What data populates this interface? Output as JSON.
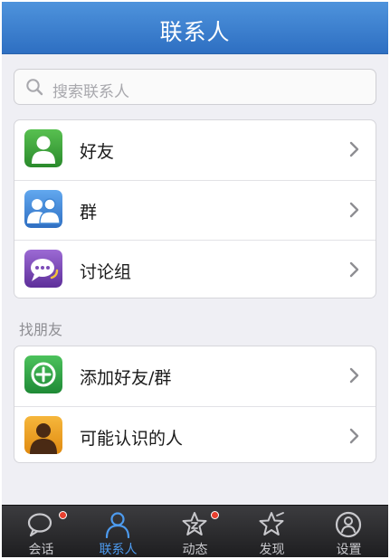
{
  "header": {
    "title": "联系人"
  },
  "search": {
    "placeholder": "搜索联系人",
    "icon": "search-icon"
  },
  "contact_groups": [
    {
      "label": "好友",
      "icon": "friend-avatar-icon",
      "color": "#3aa13a"
    },
    {
      "label": "群",
      "icon": "group-avatar-icon",
      "color": "#3f87d6"
    },
    {
      "label": "讨论组",
      "icon": "discussion-chat-icon",
      "color": "#7d4cb8"
    }
  ],
  "find_friends": {
    "section_label": "找朋友",
    "items": [
      {
        "label": "添加好友/群",
        "icon": "add-circle-icon",
        "color": "#2fa84a"
      },
      {
        "label": "可能认识的人",
        "icon": "person-silhouette-icon",
        "color": "#f0a020"
      }
    ]
  },
  "tabbar": {
    "active_color": "#4d9bef",
    "tabs": [
      {
        "label": "会话",
        "icon": "chat-bubble-icon",
        "badge": true,
        "active": false
      },
      {
        "label": "联系人",
        "icon": "person-icon",
        "badge": false,
        "active": true
      },
      {
        "label": "动态",
        "icon": "star-icon",
        "badge": true,
        "active": false
      },
      {
        "label": "发现",
        "icon": "discover-star-icon",
        "badge": false,
        "active": false
      },
      {
        "label": "设置",
        "icon": "settings-person-icon",
        "badge": false,
        "active": false
      }
    ]
  }
}
